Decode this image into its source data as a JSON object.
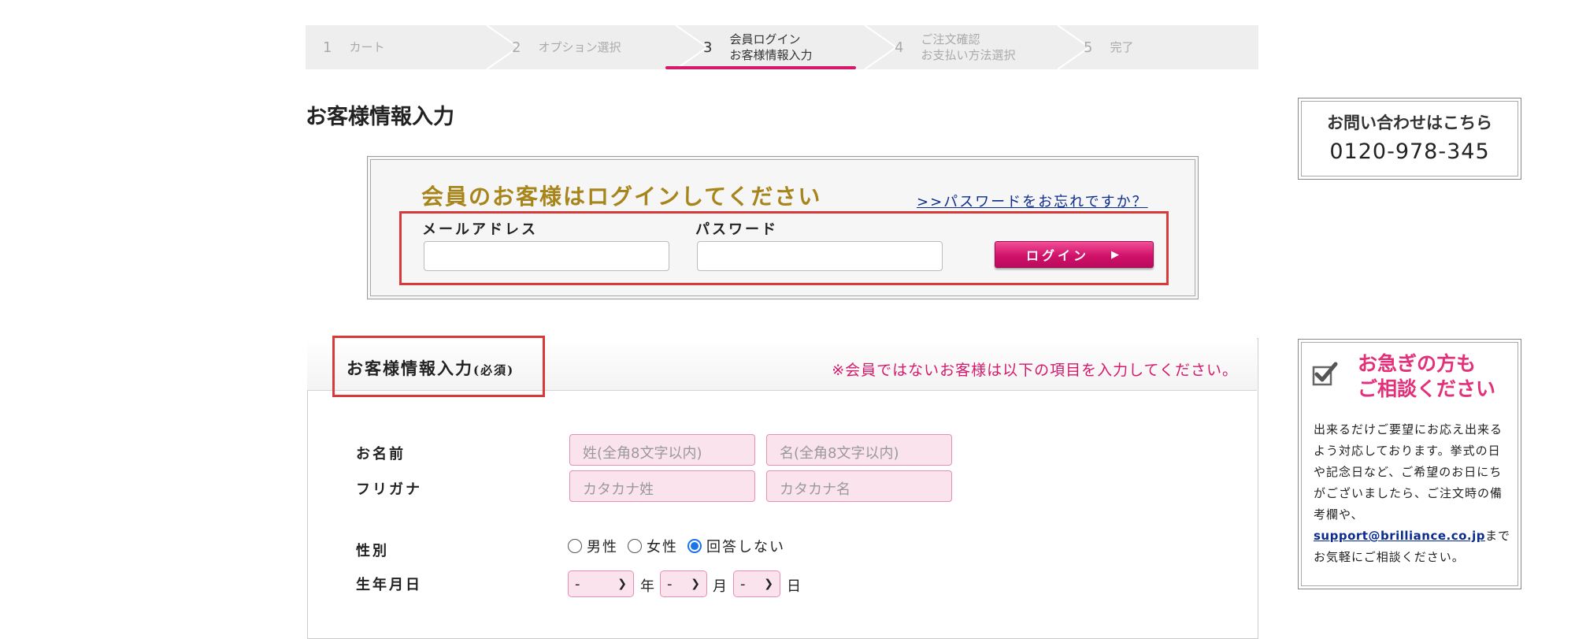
{
  "steps": [
    {
      "num": "1",
      "label": "カート"
    },
    {
      "num": "2",
      "label": "オプション選択"
    },
    {
      "num": "3",
      "label_line1": "会員ログイン",
      "label_line2": "お客様情報入力"
    },
    {
      "num": "4",
      "label_line1": "ご注文確認",
      "label_line2": "お支払い方法選択"
    },
    {
      "num": "5",
      "label": "完了"
    }
  ],
  "page_title": "お客様情報入力",
  "login": {
    "title": "会員のお客様はログインしてください",
    "forgot_link": ">>パスワードをお忘れですか？",
    "email_label": "メールアドレス",
    "password_label": "パスワード",
    "button_label": "ログイン",
    "button_arrow": "▶"
  },
  "contact": {
    "title": "お問い合わせはこちら",
    "phone": "0120-978-345"
  },
  "form": {
    "title": "お客様情報入力",
    "required": "(必須)",
    "notice": "※会員ではないお客様は以下の項目を入力してください。",
    "name_label": "お名前",
    "last_name_placeholder": "姓(全角8文字以内)",
    "first_name_placeholder": "名(全角8文字以内)",
    "kana_label": "フリガナ",
    "kana_last_placeholder": "カタカナ姓",
    "kana_first_placeholder": "カタカナ名",
    "gender_label": "性別",
    "gender_options": [
      "男性",
      "女性",
      "回答しない"
    ],
    "gender_selected": "回答しない",
    "birthday_label": "生年月日",
    "year_value": "-",
    "year_unit": "年",
    "month_value": "-",
    "month_unit": "月",
    "day_value": "-",
    "day_unit": "日"
  },
  "urgent": {
    "title_line1": "お急ぎの方も",
    "title_line2": "ご相談ください",
    "body_before_link": "出来るだけご要望にお応え出来るよう対応しております。挙式の日や記念日など、ご希望のお日にちがございましたら、ご注文時の備考欄や、",
    "email_link": "support@brilliance.co.jp",
    "body_after_link": "までお気軽にご相談ください。"
  },
  "colors": {
    "accent_pink": "#d6186b",
    "gold_title": "#a8851a",
    "highlight_red": "#d83a3a",
    "link_blue": "#0b2c8f"
  }
}
